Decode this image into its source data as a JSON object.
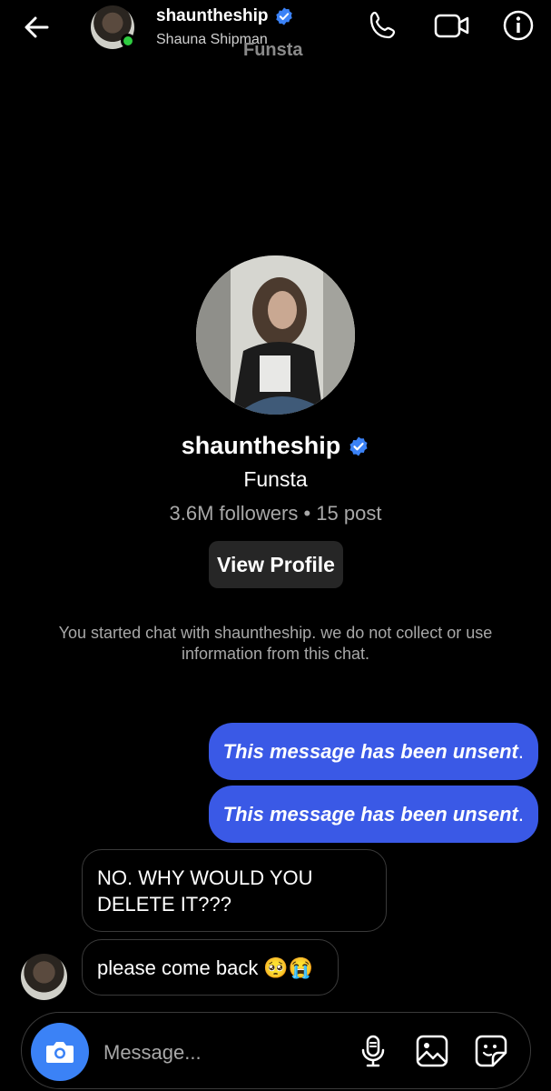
{
  "header": {
    "username": "shauntheship",
    "full_name": "Shauna Shipman",
    "overlay_tag": "Funsta",
    "icons": [
      "back-arrow-icon",
      "phone-icon",
      "video-icon",
      "info-icon"
    ]
  },
  "profile": {
    "username": "shauntheship",
    "tagline": "Funsta",
    "stats": "3.6M followers • 15 post",
    "view_profile_label": "View Profile"
  },
  "notice": "You started chat with shauntheship. we do not collect or use information from this chat.",
  "messages": [
    {
      "direction": "out",
      "text": "This message has been unsent",
      "suffix": "."
    },
    {
      "direction": "out",
      "text": "This message has been unsent",
      "suffix": "."
    },
    {
      "direction": "in",
      "text": "NO. WHY WOULD YOU DELETE IT???"
    },
    {
      "direction": "in",
      "text": "please come back 🥺😭"
    }
  ],
  "composer": {
    "placeholder": "Message...",
    "icons": [
      "camera-icon",
      "microphone-icon",
      "gallery-icon",
      "sticker-icon"
    ]
  },
  "colors": {
    "accent_blue": "#3b82f6",
    "outgoing_bubble": "#3a59e6",
    "online": "#2ecc40",
    "background": "#000000"
  }
}
